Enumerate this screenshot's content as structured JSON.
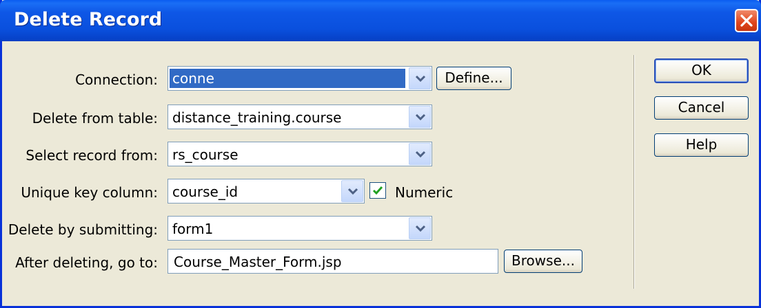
{
  "window": {
    "title": "Delete Record"
  },
  "fields": [
    {
      "label": "Connection:",
      "value": "conne",
      "type": "select"
    },
    {
      "label": "Delete from table:",
      "value": "distance_training.course",
      "type": "select"
    },
    {
      "label": "Select record from:",
      "value": "rs_course",
      "type": "select"
    },
    {
      "label": "Unique key column:",
      "value": "course_id",
      "type": "select"
    },
    {
      "label": "Delete by submitting:",
      "value": "form1",
      "type": "select"
    },
    {
      "label": "After deleting, go to:",
      "value": "Course_Master_Form.jsp",
      "type": "text"
    }
  ],
  "define_label": "Define...",
  "browse_label": "Browse...",
  "numeric": {
    "label": "Numeric",
    "checked": true
  },
  "buttons": {
    "ok": "OK",
    "cancel": "Cancel",
    "help": "Help"
  },
  "icons": [
    "close-icon",
    "chevron-down-icon",
    "checkmark-icon"
  ],
  "colors": {
    "titlebar": "#0a50de",
    "selection": "#316ac5",
    "background": "#ece9d8"
  }
}
